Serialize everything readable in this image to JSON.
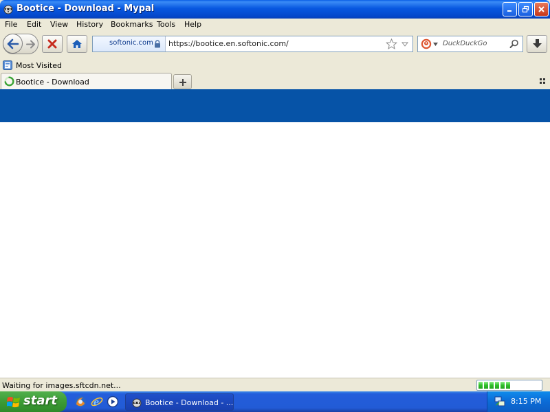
{
  "window": {
    "title": "Bootice - Download - Mypal",
    "icon": "raccoon-icon",
    "controls": [
      "minimize-icon",
      "restore-icon",
      "close-icon"
    ]
  },
  "menu": {
    "items": [
      "File",
      "Edit",
      "View",
      "History",
      "Bookmarks",
      "Tools",
      "Help"
    ]
  },
  "navbar": {
    "site_identity": "softonic.com",
    "url": "https://bootice.en.softonic.com/",
    "search_placeholder": "DuckDuckGo",
    "search_engine_icon": "duckduckgo-icon"
  },
  "bookmarks": {
    "items": [
      {
        "label": "Most Visited",
        "icon": "most-visited-icon"
      }
    ]
  },
  "tabs": [
    {
      "label": "Bootice - Download",
      "loading": true
    }
  ],
  "page": {
    "header_color": "#0653a7"
  },
  "status": {
    "text": "Waiting for images.sftcdn.net...",
    "progress_percent": 55
  },
  "taskbar": {
    "start_label": "start",
    "quick_launch": [
      "firefox-icon",
      "internet-explorer-icon",
      "media-player-icon"
    ],
    "tasks": [
      {
        "label": "Bootice - Download - ...",
        "icon": "raccoon-icon"
      }
    ],
    "clock": "8:15 PM"
  },
  "colors": {
    "xp_blue": "#0858e0",
    "start_green": "#3c9b35",
    "header_blue": "#0653a7"
  }
}
